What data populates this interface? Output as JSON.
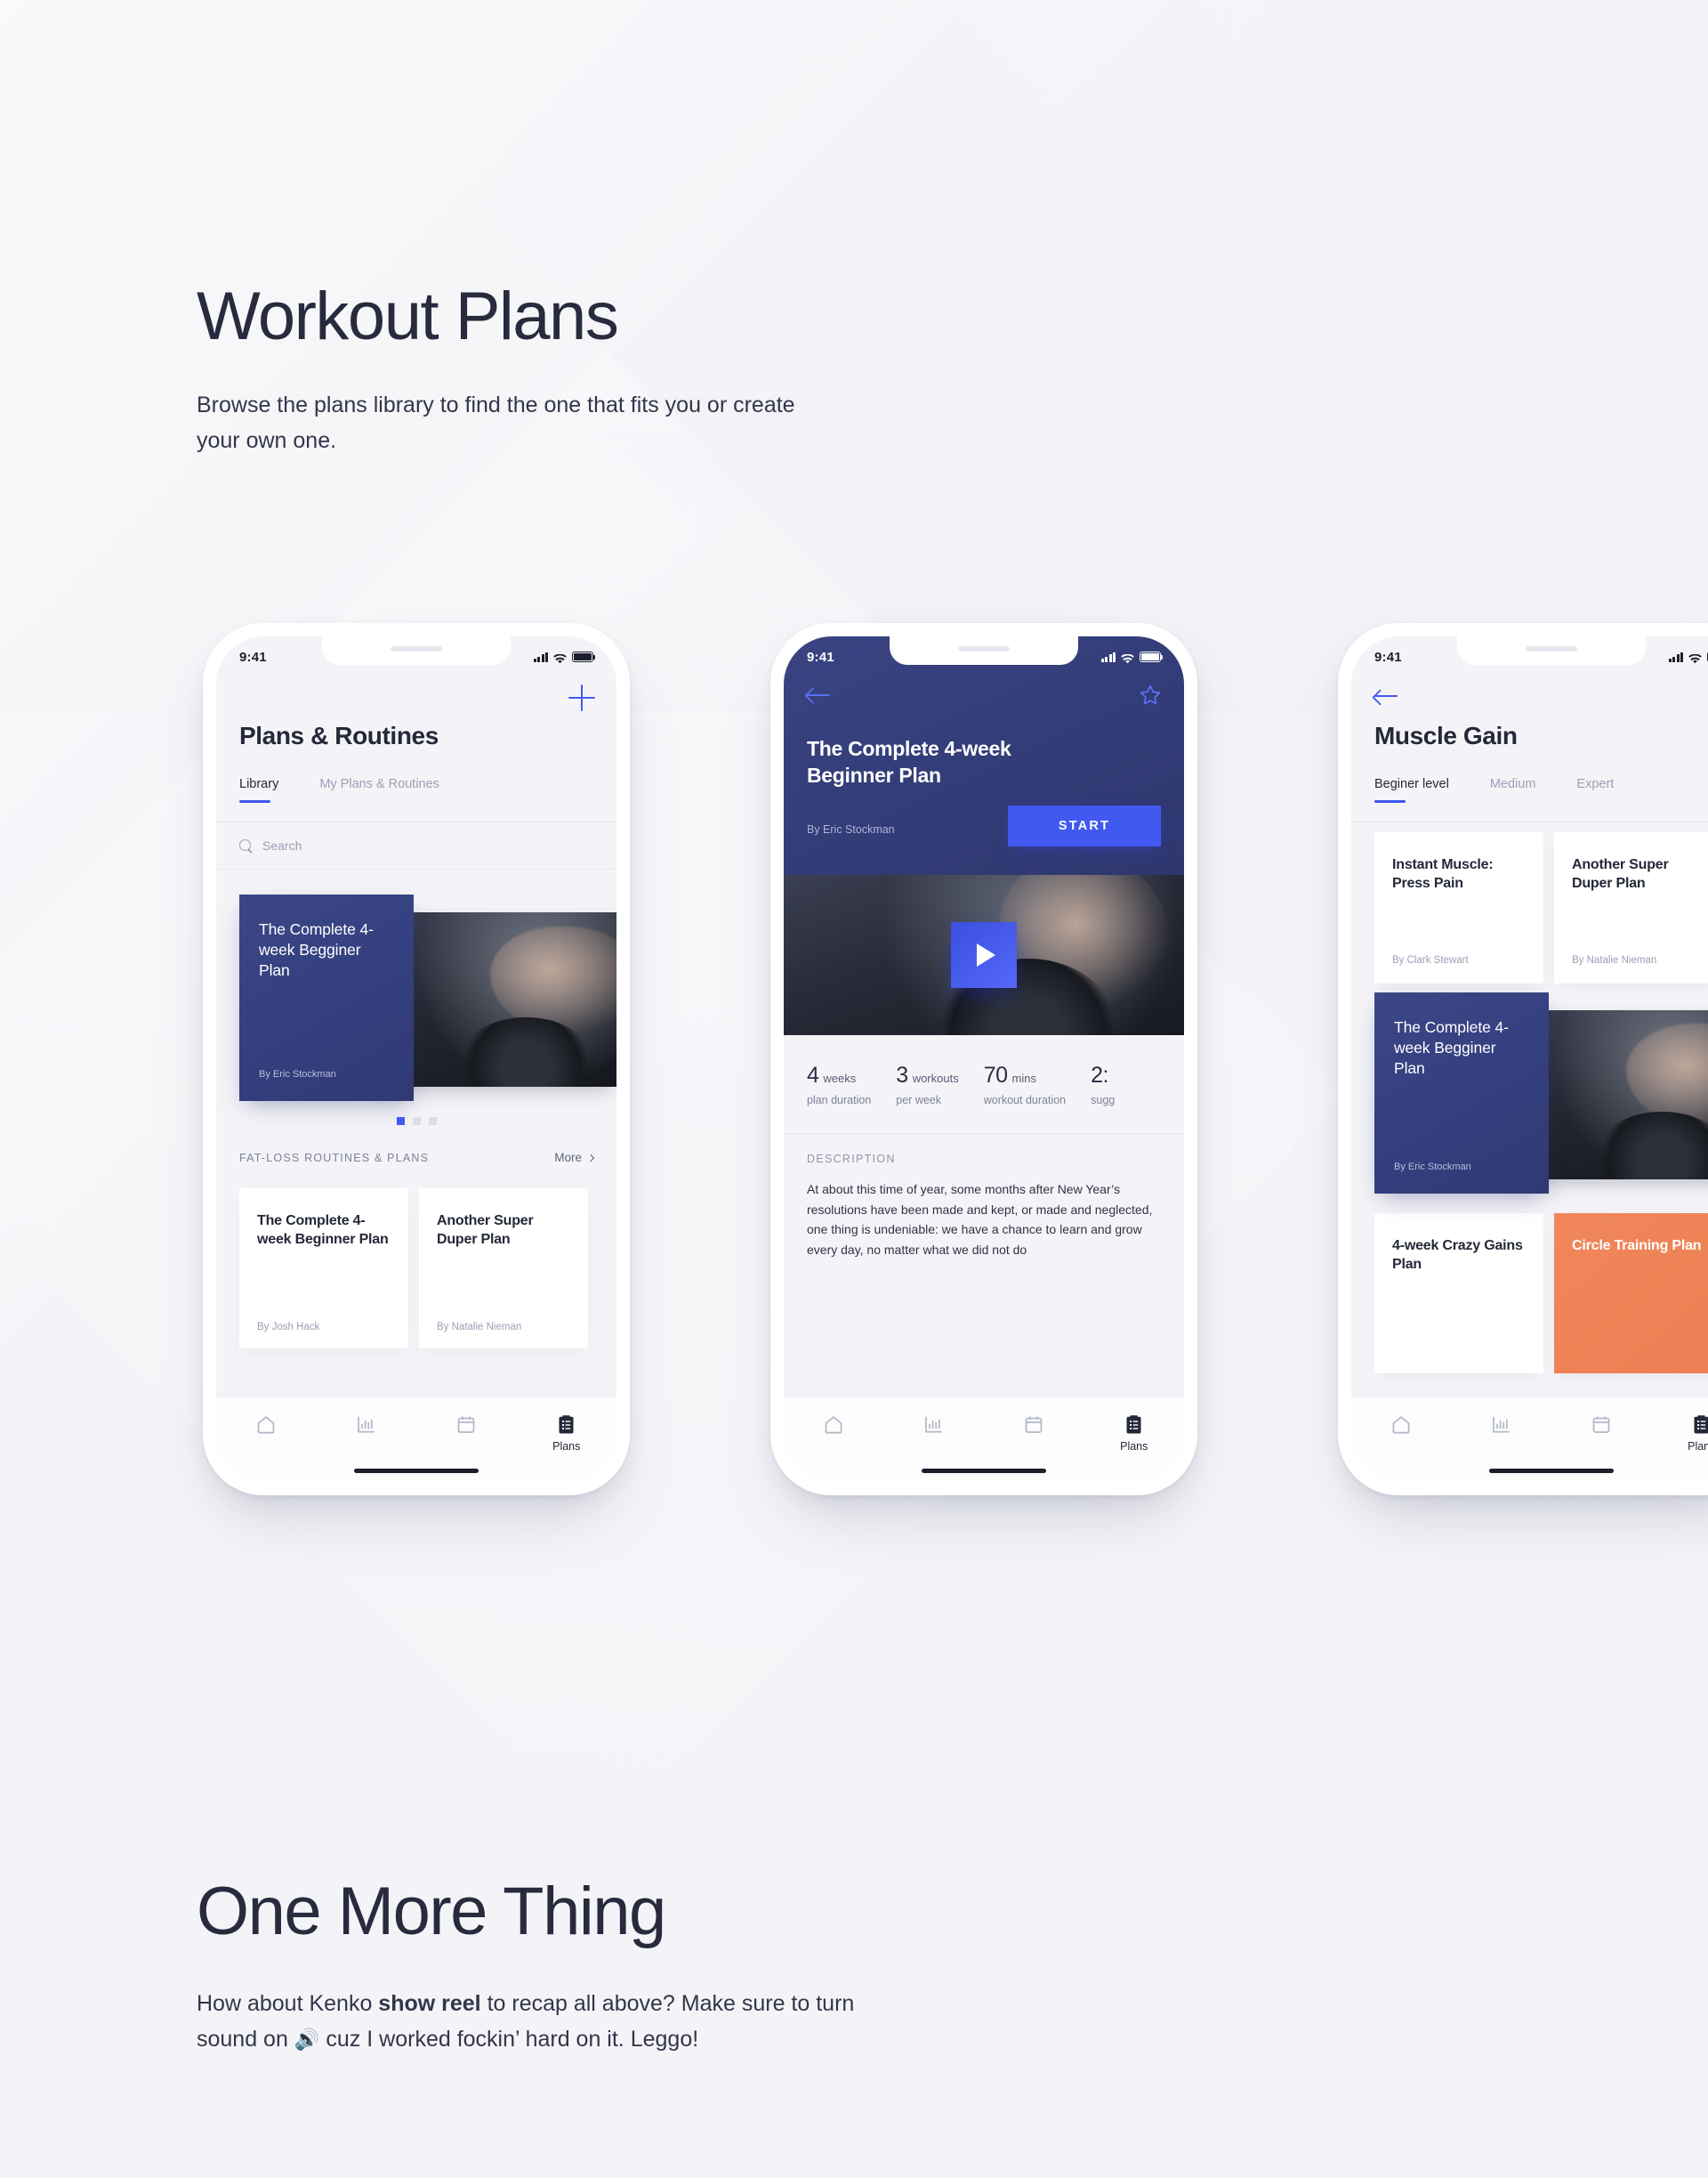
{
  "page": {
    "section_top": {
      "title": "Workout Plans",
      "body": "Browse the plans library to find the one that fits you or create your own one."
    },
    "section_bottom": {
      "title": "One More Thing",
      "body_part1": "How about Kenko ",
      "body_bold": "show reel",
      "body_part2": " to recap all above? Make sure to turn sound on ",
      "body_emoji": "🔊",
      "body_part3": " cuz I worked fockin’ hard on it. Leggo!"
    }
  },
  "phone1": {
    "status": {
      "time": "9:41"
    },
    "add_button": "+",
    "title": "Plans & Routines",
    "tabs": [
      {
        "label": "Library",
        "active": true
      },
      {
        "label": "My Plans & Routines",
        "active": false
      }
    ],
    "search": {
      "placeholder": "Search"
    },
    "hero": {
      "title": "The Complete 4-week Begginer Plan",
      "author": "By Eric Stockman"
    },
    "pagination": {
      "count": 3,
      "active": 1
    },
    "section": {
      "label": "FAT-LOSS ROUTINES & PLANS",
      "more": "More"
    },
    "cards": [
      {
        "title": "The Complete 4-week Beginner Plan",
        "author": "By Josh Hack"
      },
      {
        "title": "Another Super Duper Plan",
        "author": "By Natalie Nieman"
      }
    ],
    "tabbar": [
      {
        "icon": "home-icon",
        "label": "",
        "active": false
      },
      {
        "icon": "stats-icon",
        "label": "",
        "active": false
      },
      {
        "icon": "calendar-icon",
        "label": "",
        "active": false
      },
      {
        "icon": "clipboard-icon",
        "label": "Plans",
        "active": true
      }
    ]
  },
  "phone2": {
    "status": {
      "time": "9:41"
    },
    "title": "The Complete 4-week Beginner Plan",
    "author": "By Eric Stockman",
    "start_button": "START",
    "stats": [
      {
        "value": "4",
        "unit": "weeks",
        "caption": "plan duration"
      },
      {
        "value": "3",
        "unit": "workouts",
        "caption": "per week"
      },
      {
        "value": "70",
        "unit": "mins",
        "caption": "workout duration"
      },
      {
        "value": "2:",
        "unit": "",
        "caption": "sugg"
      }
    ],
    "description": {
      "heading": "DESCRIPTION",
      "body": "At about this time of year, some months after New Year’s resolutions have been made and kept, or made and neglected, one thing is undeniable: we have a chance to learn and grow every day, no matter what we did not do"
    },
    "tabbar": [
      {
        "icon": "home-icon",
        "label": "",
        "active": false
      },
      {
        "icon": "stats-icon",
        "label": "",
        "active": false
      },
      {
        "icon": "calendar-icon",
        "label": "",
        "active": false
      },
      {
        "icon": "clipboard-icon",
        "label": "Plans",
        "active": true
      }
    ]
  },
  "phone3": {
    "status": {
      "time": "9:41"
    },
    "title": "Muscle Gain",
    "tabs": [
      {
        "label": "Beginer level",
        "active": true
      },
      {
        "label": "Medium",
        "active": false
      },
      {
        "label": "Expert",
        "active": false
      }
    ],
    "cards_row1": [
      {
        "title": "Instant Muscle: Press Pain",
        "author": "By Clark Stewart"
      },
      {
        "title": "Another Super Duper Plan",
        "author": "By Natalie Nieman"
      }
    ],
    "hero": {
      "title": "The Complete 4-week Begginer Plan",
      "author": "By Eric Stockman"
    },
    "cards_row2": [
      {
        "title": "4-week Crazy Gains Plan",
        "author": "",
        "accent": false
      },
      {
        "title": "Circle Training Plan",
        "author": "",
        "accent": true
      }
    ],
    "tabbar": [
      {
        "icon": "home-icon",
        "label": "",
        "active": false
      },
      {
        "icon": "stats-icon",
        "label": "",
        "active": false
      },
      {
        "icon": "calendar-icon",
        "label": "",
        "active": false
      },
      {
        "icon": "clipboard-icon",
        "label": "Plans",
        "active": true
      }
    ]
  },
  "colors": {
    "background": "#f4f4f8",
    "accent_blue": "#4159f0",
    "navy": "#2f3a74",
    "ink": "#242838",
    "muted": "#9aa0b4",
    "orange": "#ef8154"
  }
}
